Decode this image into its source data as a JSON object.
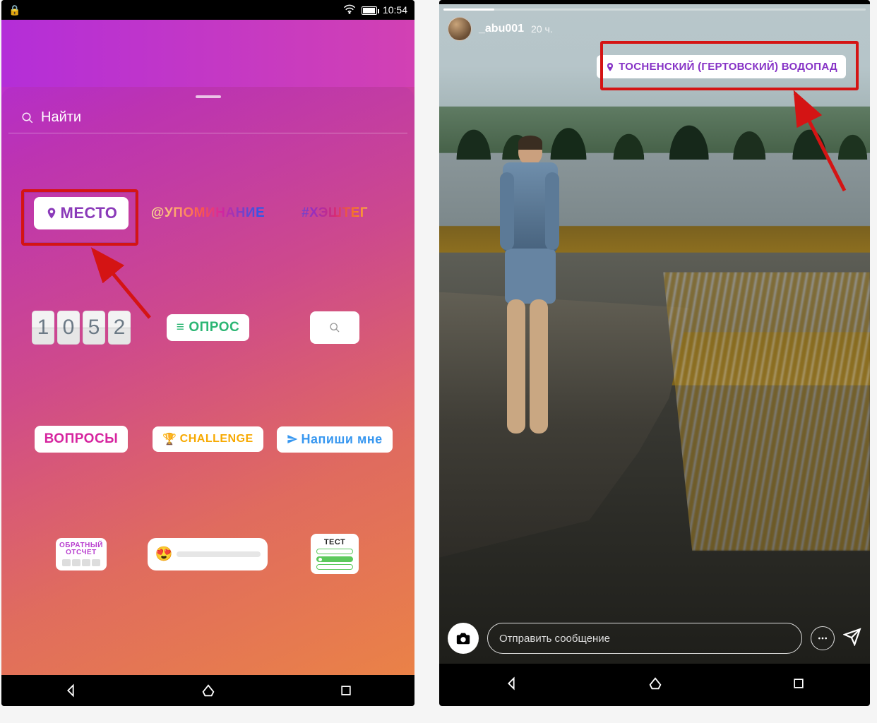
{
  "left": {
    "statusbar": {
      "time": "10:54"
    },
    "search": {
      "placeholder": "Найти"
    },
    "stickers": {
      "location": "МЕСТО",
      "mention": "@УПОМИНАНИЕ",
      "hashtag": "#ХЭШТЕГ",
      "clock_digits": [
        "1",
        "0",
        "5",
        "2"
      ],
      "poll": "ОПРОС",
      "questions": "ВОПРОСЫ",
      "challenge": "CHALLENGE",
      "dm": "Напиши мне",
      "countdown": {
        "line1": "ОБРАТНЫЙ",
        "line2": "ОТСЧЕТ"
      },
      "test": "ТЕСТ"
    }
  },
  "right": {
    "user": "_abu001",
    "timestamp": "20 ч.",
    "location_sticker": "ТОСНЕНСКИЙ (ГЕРТОВСКИЙ) ВОДОПАД",
    "reply_placeholder": "Отправить сообщение"
  }
}
